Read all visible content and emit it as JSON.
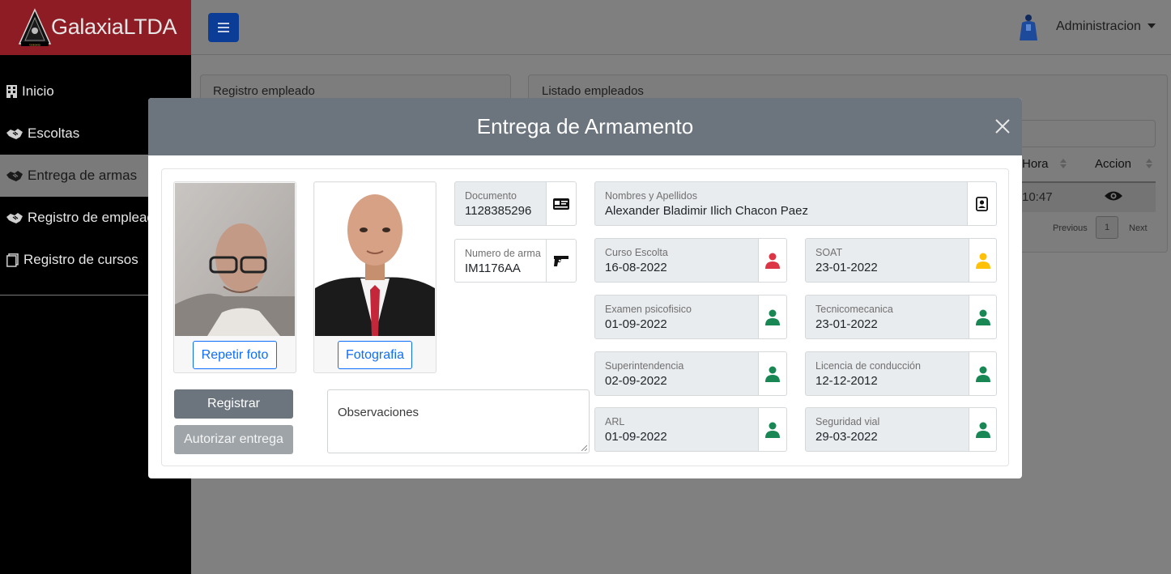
{
  "brand": {
    "name": "GalaxiaLTDA",
    "logo_text": "Galaxia"
  },
  "sidebar": {
    "items": [
      {
        "label": "Inicio",
        "icon": "building-icon"
      },
      {
        "label": "Escoltas",
        "icon": "handshake-icon"
      },
      {
        "label": "Entrega de armas",
        "icon": "handshake-icon",
        "active": true
      },
      {
        "label": "Registro de empleados",
        "icon": "handshake-icon"
      },
      {
        "label": "Registro de cursos",
        "icon": "copy-icon"
      }
    ]
  },
  "topbar": {
    "user_menu": "Administracion"
  },
  "background": {
    "card_left_title": "Registro empleado",
    "card_right_title": "Listado empleados",
    "table": {
      "headers": [
        "Hora",
        "Accion"
      ],
      "row_hora": "10:47",
      "pagination": {
        "previous": "Previous",
        "page": "1",
        "next": "Next"
      }
    }
  },
  "modal": {
    "title": "Entrega de Armamento",
    "repeat_photo_label": "Repetir foto",
    "photo_label": "Fotografia",
    "register_label": "Registrar",
    "authorize_label": "Autorizar entrega",
    "observations_placeholder": "Observaciones",
    "fields": {
      "documento": {
        "label": "Documento",
        "value": "1128385296"
      },
      "numero_arma": {
        "label": "Numero de arma",
        "value": "IM1176AA"
      },
      "nombres": {
        "label": "Nombres y Apellidos",
        "value": "Alexander Bladimir Ilich Chacon Paez"
      },
      "curso_escolta": {
        "label": "Curso Escolta",
        "value": "16-08-2022",
        "status": "red"
      },
      "soat": {
        "label": "SOAT",
        "value": "23-01-2022",
        "status": "yellow"
      },
      "examen": {
        "label": "Examen psicofisico",
        "value": "01-09-2022",
        "status": "green"
      },
      "tecnomecanica": {
        "label": "Tecnicomecanica",
        "value": "23-01-2022",
        "status": "green"
      },
      "superintendencia": {
        "label": "Superintendencia",
        "value": "02-09-2022",
        "status": "green"
      },
      "licencia": {
        "label": "Licencia de conducción",
        "value": "12-12-2012",
        "status": "green"
      },
      "arl": {
        "label": "ARL",
        "value": "01-09-2022",
        "status": "green"
      },
      "seguridad_vial": {
        "label": "Seguridad vial",
        "value": "29-03-2022",
        "status": "green"
      }
    }
  },
  "colors": {
    "brand_red": "#8e1c24",
    "modal_header": "#6c757d",
    "primary": "#0d6efd",
    "status_red": "#dc3545",
    "status_yellow": "#ffc107",
    "status_green": "#198754"
  }
}
